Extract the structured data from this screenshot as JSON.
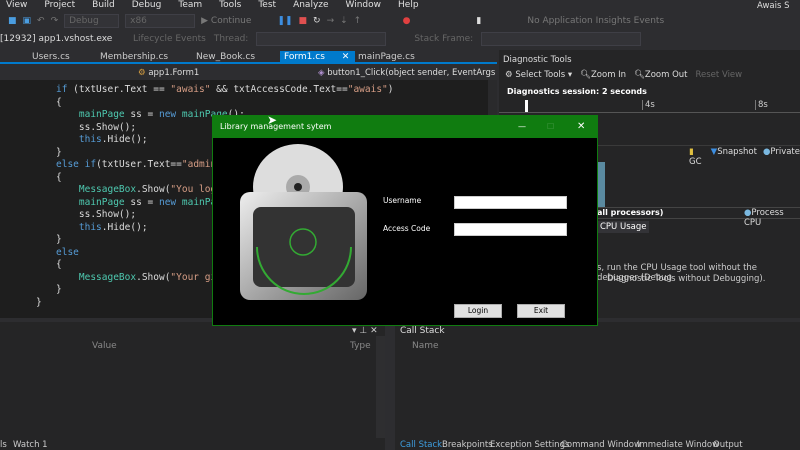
{
  "menu": [
    "View",
    "Project",
    "Build",
    "Debug",
    "Team",
    "Tools",
    "Test",
    "Analyze",
    "Window",
    "Help"
  ],
  "user": "Awais S",
  "toolbar": {
    "config": "Debug",
    "platform": "x86",
    "continue": "Continue",
    "insights": "No Application Insights Events"
  },
  "toolbar2": {
    "process": "[12932] app1.vshost.exe",
    "lifecycle": "Lifecycle Events",
    "thread": "Thread:",
    "stack_frame": "Stack Frame:"
  },
  "tabs": [
    {
      "label": "Users.cs"
    },
    {
      "label": "Membership.cs"
    },
    {
      "label": "New_Book.cs"
    },
    {
      "label": "Form1.cs",
      "active": true
    },
    {
      "label": "mainPage.cs"
    }
  ],
  "navbar": {
    "class": "app1.Form1",
    "method": "button1_Click(object sender, EventArgs e)"
  },
  "code": [
    "if (txtUser.Text == \"awais\" && txtAccessCode.Text==\"awais\")",
    "{",
    "    mainPage ss = new mainPage();",
    "    ss.Show();",
    "    this.Hide();",
    "}",
    "else if(txtUser.Text==\"admin\"&",
    "{",
    "    MessageBox.Show(\"You logi",
    "    mainPage ss = new mainPage",
    "    ss.Show();",
    "    this.Hide();",
    "}",
    "else",
    "{",
    "    MessageBox.Show(\"Your give",
    "}",
    "}"
  ],
  "diagnostics": {
    "title": "Diagnostic Tools",
    "select_tools": "Select Tools",
    "zoom_in": "Zoom In",
    "zoom_out": "Zoom Out",
    "reset_view": "Reset View",
    "session": "Diagnostics session: 2 seconds",
    "tick_4": "4s",
    "tick_8": "8s",
    "legend": [
      "GC",
      "Snapshot",
      "Private"
    ],
    "cpu_label": "all processors)",
    "process_cpu": "Process CPU",
    "cpu_tab": "CPU Usage",
    "message1": "s, run the CPU Usage tool without the debugger (Debug",
    "message2": "Diagnostic Tools without Debugging)."
  },
  "dialog": {
    "title": "Library management sytem",
    "username_label": "Username",
    "access_label": "Access Code",
    "username": "",
    "access_code": "",
    "login": "Login",
    "exit": "Exit"
  },
  "locals": {
    "col_value": "Value",
    "col_type": "Type",
    "tabs": [
      "ls",
      "Watch 1"
    ]
  },
  "callstack": {
    "title": "Call Stack",
    "col_name": "Name",
    "tabs": [
      "Call Stack",
      "Breakpoints",
      "Exception Settings",
      "Command Window",
      "Immediate Window",
      "Output"
    ]
  }
}
